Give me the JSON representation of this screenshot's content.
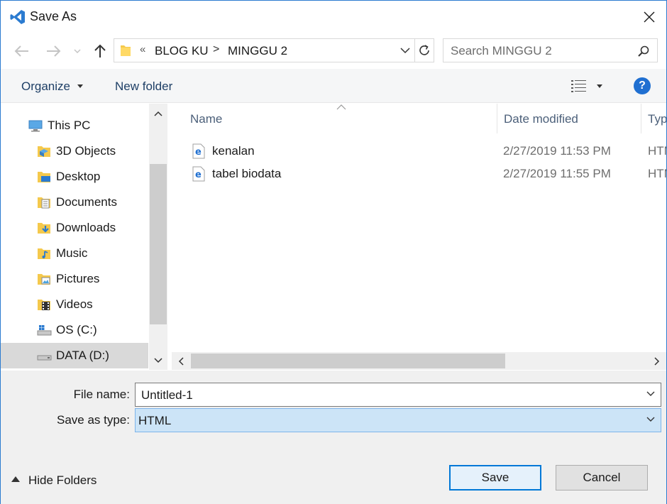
{
  "window": {
    "title": "Save As",
    "close_glyph": "✕"
  },
  "nav": {
    "back_glyph": "←",
    "forward_glyph": "→",
    "recent_glyph": "⌄",
    "up_glyph": "↑",
    "overflow": "«",
    "breadcrumbs": [
      "BLOG KU",
      "MINGGU 2"
    ],
    "separator": ">",
    "refresh_glyph": "↻"
  },
  "search": {
    "placeholder": "Search MINGGU 2"
  },
  "toolbar": {
    "organize": "Organize",
    "new_folder": "New folder",
    "help": "?"
  },
  "sidebar": {
    "items": [
      {
        "label": "This PC",
        "icon": "this-pc-icon"
      },
      {
        "label": "3D Objects",
        "icon": "3d-objects-icon"
      },
      {
        "label": "Desktop",
        "icon": "desktop-icon"
      },
      {
        "label": "Documents",
        "icon": "documents-icon"
      },
      {
        "label": "Downloads",
        "icon": "downloads-icon"
      },
      {
        "label": "Music",
        "icon": "music-icon"
      },
      {
        "label": "Pictures",
        "icon": "pictures-icon"
      },
      {
        "label": "Videos",
        "icon": "videos-icon"
      },
      {
        "label": "OS (C:)",
        "icon": "drive-c-icon"
      },
      {
        "label": "DATA (D:)",
        "icon": "drive-d-icon",
        "selected": true
      }
    ]
  },
  "filelist": {
    "columns": [
      "Name",
      "Date modified",
      "Type"
    ],
    "files": [
      {
        "name": "kenalan",
        "date": "2/27/2019 11:53 PM",
        "type": "HTML",
        "icon": "html-file-icon"
      },
      {
        "name": "tabel biodata",
        "date": "2/27/2019 11:55 PM",
        "type": "HTML",
        "icon": "html-file-icon"
      }
    ]
  },
  "form": {
    "file_name_label": "File name:",
    "file_name_value": "Untitled-1",
    "save_type_label": "Save as type:",
    "save_type_value": "HTML"
  },
  "footer": {
    "hide_folders": "Hide Folders",
    "save": "Save",
    "cancel": "Cancel"
  },
  "colors": {
    "accent": "#0078d7",
    "vscode_blue": "#2b7bd0",
    "folder_yellow": "#f5c94c",
    "selected_bg": "#d9d9d9",
    "savetype_bg": "#cce4f7"
  }
}
